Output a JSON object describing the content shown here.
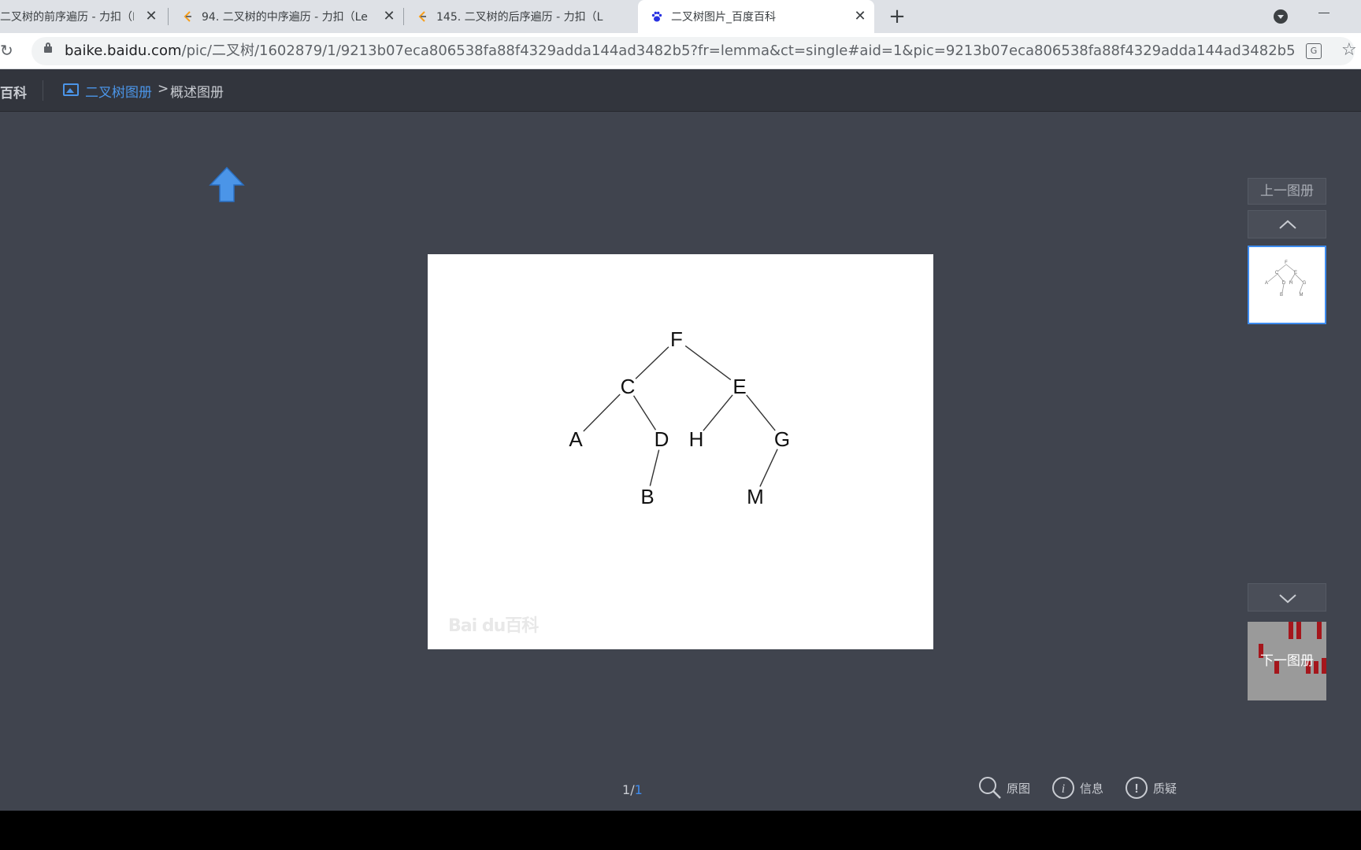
{
  "tabs": [
    {
      "title": "二叉树的前序遍历 - 力扣（L",
      "favicon": "leetcode-icon",
      "active": false
    },
    {
      "title": "94. 二叉树的中序遍历 - 力扣（Le",
      "favicon": "leetcode-icon",
      "active": false
    },
    {
      "title": "145. 二叉树的后序遍历 - 力扣（L",
      "favicon": "leetcode-icon",
      "active": false
    },
    {
      "title": "二叉树图片_百度百科",
      "favicon": "baidu-paw-icon",
      "active": true
    }
  ],
  "address": {
    "host": "baike.baidu.com",
    "path": "/pic/二叉树/1602879/1/9213b07eca806538fa88f4329adda144ad3482b5?fr=lemma&ct=single#aid=1&pic=9213b07eca806538fa88f4329adda144ad3482b5"
  },
  "header": {
    "logo": "百科",
    "breadcrumb_link": "二叉树图册",
    "breadcrumb_sep": ">",
    "breadcrumb_current": "概述图册"
  },
  "tree": {
    "nodes": [
      "F",
      "C",
      "E",
      "A",
      "D",
      "H",
      "G",
      "B",
      "M"
    ],
    "edges": [
      [
        "F",
        "C"
      ],
      [
        "F",
        "E"
      ],
      [
        "C",
        "A"
      ],
      [
        "C",
        "D"
      ],
      [
        "E",
        "H"
      ],
      [
        "E",
        "G"
      ],
      [
        "D",
        "B"
      ],
      [
        "G",
        "M"
      ]
    ]
  },
  "watermark": "Bai du百科",
  "sidebar": {
    "prev_album": "上一图册",
    "next_album": "下一图册"
  },
  "pager": {
    "current": "1",
    "separator": "/",
    "total": "1"
  },
  "tools": [
    {
      "label": "原图",
      "icon": "magnifier-icon"
    },
    {
      "label": "信息",
      "icon": "info-icon"
    },
    {
      "label": "质疑",
      "icon": "exclamation-icon"
    }
  ],
  "colors": {
    "viewer_bg": "#40444e",
    "header_bg": "#32353d",
    "accent": "#4b95e8"
  }
}
